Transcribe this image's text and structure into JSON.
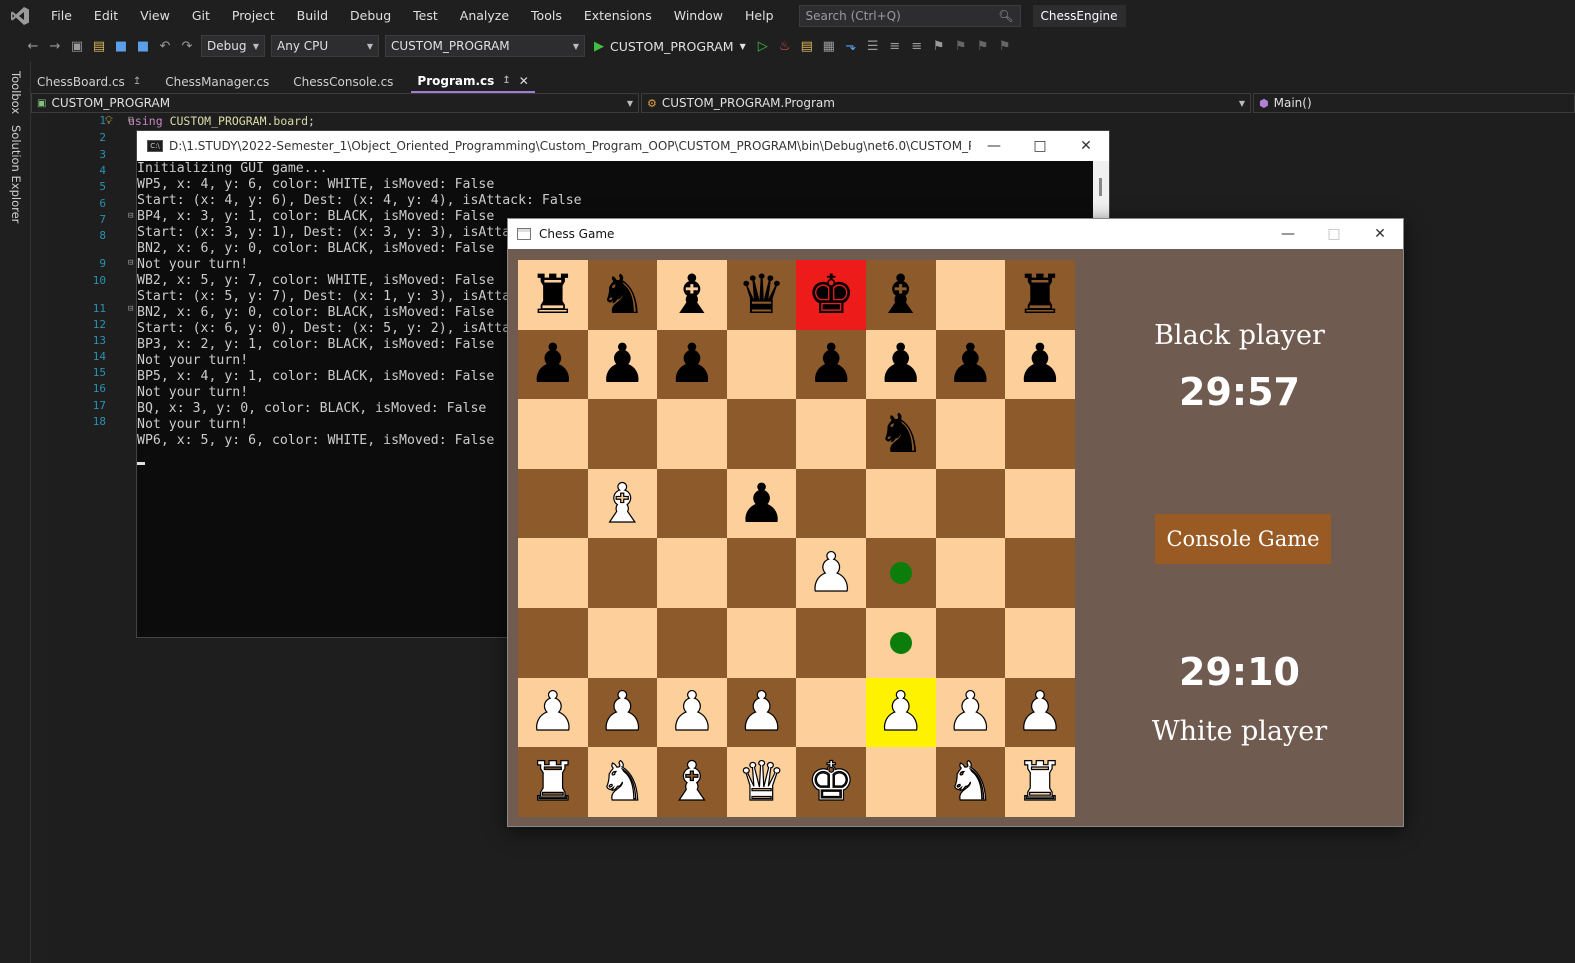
{
  "menubar": {
    "items": [
      "File",
      "Edit",
      "View",
      "Git",
      "Project",
      "Build",
      "Debug",
      "Test",
      "Analyze",
      "Tools",
      "Extensions",
      "Window",
      "Help"
    ],
    "search_placeholder": "Search (Ctrl+Q)",
    "solution_name": "ChessEngine"
  },
  "toolbar": {
    "configuration": "Debug",
    "platform": "Any CPU",
    "startup_project": "CUSTOM_PROGRAM",
    "run_label": "CUSTOM_PROGRAM"
  },
  "side": {
    "toolbox": "Toolbox",
    "solution_explorer": "Solution Explorer"
  },
  "tabs": [
    {
      "label": "ChessBoard.cs"
    },
    {
      "label": "ChessManager.cs"
    },
    {
      "label": "ChessConsole.cs"
    },
    {
      "label": "Program.cs"
    }
  ],
  "navbar": {
    "project": "CUSTOM_PROGRAM",
    "class": "CUSTOM_PROGRAM.Program",
    "member": "Main()"
  },
  "editor": {
    "line_numbers": [
      "1",
      "2",
      "3",
      "4",
      "5",
      "6",
      "7",
      "8",
      "9",
      "10",
      "11",
      "12",
      "13",
      "14",
      "15",
      "16",
      "17",
      "18"
    ],
    "code_keyword": "using",
    "code_namespace": "CUSTOM_PROGRAM.board",
    "code_semicolon": ";"
  },
  "console": {
    "title": "D:\\1.STUDY\\2022-Semester_1\\Object_Oriented_Programming\\Custom_Program_OOP\\CUSTOM_PROGRAM\\bin\\Debug\\net6.0\\CUSTOM_PROGRAM.exe",
    "lines": [
      "Initializing GUI game...",
      "WP5, x: 4, y: 6, color: WHITE, isMoved: False",
      "Start: (x: 4, y: 6), Dest: (x: 4, y: 4), isAttack: False",
      "BP4, x: 3, y: 1, color: BLACK, isMoved: False",
      "Start: (x: 3, y: 1), Dest: (x: 3, y: 3), isAtta",
      "BN2, x: 6, y: 0, color: BLACK, isMoved: False",
      "Not your turn!",
      "WB2, x: 5, y: 7, color: WHITE, isMoved: False",
      "Start: (x: 5, y: 7), Dest: (x: 1, y: 3), isAtta",
      "BN2, x: 6, y: 0, color: BLACK, isMoved: False",
      "Start: (x: 6, y: 0), Dest: (x: 5, y: 2), isAtta",
      "BP3, x: 2, y: 1, color: BLACK, isMoved: False",
      "Not your turn!",
      "BP5, x: 4, y: 1, color: BLACK, isMoved: False",
      "Not your turn!",
      "BQ, x: 3, y: 0, color: BLACK, isMoved: False",
      "Not your turn!",
      "WP6, x: 5, y: 6, color: WHITE, isMoved: False"
    ]
  },
  "chess": {
    "title": "Chess Game",
    "black_player": "Black player",
    "black_time": "29:57",
    "white_player": "White player",
    "white_time": "29:10",
    "console_game_button": "Console Game",
    "board": [
      [
        "bR",
        "bN",
        "bB",
        "bQ",
        "bK",
        "bB",
        "",
        "bR"
      ],
      [
        "bP",
        "bP",
        "bP",
        "",
        "bP",
        "bP",
        "bP",
        "bP"
      ],
      [
        "",
        "",
        "",
        "",
        "",
        "bN",
        "",
        ""
      ],
      [
        "",
        "wB",
        "",
        "bP",
        "",
        "",
        "",
        ""
      ],
      [
        "",
        "",
        "",
        "",
        "wP",
        "",
        "",
        ""
      ],
      [
        "",
        "",
        "",
        "",
        "",
        "",
        "",
        ""
      ],
      [
        "wP",
        "wP",
        "wP",
        "wP",
        "",
        "wP",
        "wP",
        "wP"
      ],
      [
        "wR",
        "wN",
        "wB",
        "wQ",
        "wK",
        "",
        "wN",
        "wR"
      ]
    ],
    "check_square": [
      0,
      4
    ],
    "selected_square": [
      6,
      5
    ],
    "move_targets": [
      [
        4,
        5
      ],
      [
        5,
        5
      ]
    ],
    "colors": {
      "light": "#fdcf9b",
      "dark": "#8c5a2b",
      "check": "#ee1b1b",
      "selected": "#fff200",
      "move_dot": "#0a7d0a",
      "panel": "#6f5b4f",
      "button": "#9a5a24"
    }
  }
}
